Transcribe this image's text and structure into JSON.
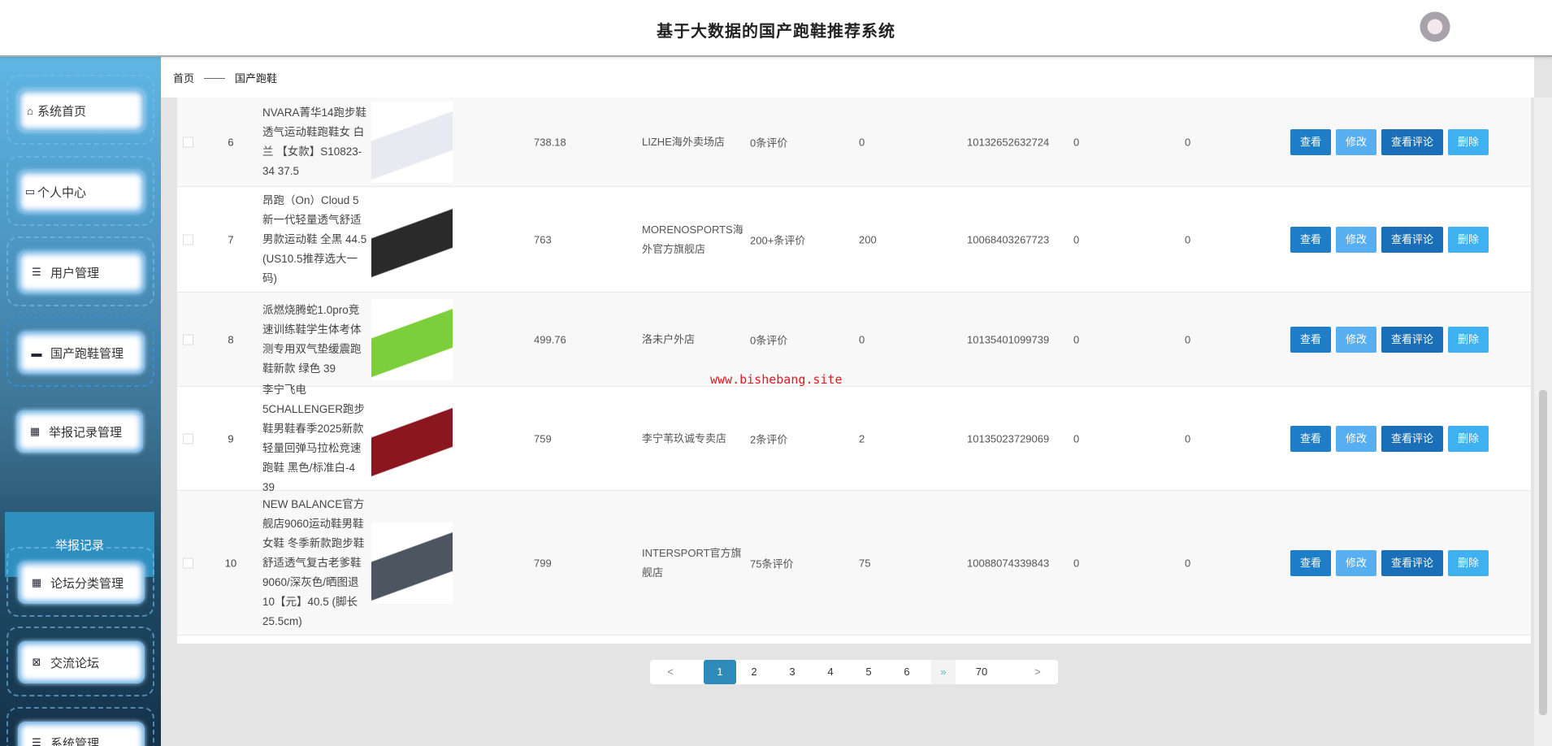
{
  "header": {
    "title": "基于大数据的国产跑鞋推荐系统"
  },
  "sidebar": {
    "items": [
      {
        "label": "系统首页",
        "icon": "home-icon"
      },
      {
        "label": "个人中心",
        "icon": "card-icon"
      },
      {
        "label": "用户管理",
        "icon": "list-icon"
      },
      {
        "label": "国产跑鞋管理",
        "icon": "monitor-icon"
      },
      {
        "label": "举报记录管理",
        "icon": "grid-icon"
      },
      {
        "label": "论坛分类管理",
        "icon": "grid-icon"
      },
      {
        "label": "交流论坛",
        "icon": "clipboard-icon"
      },
      {
        "label": "系统管理",
        "icon": "list-icon"
      }
    ],
    "sub_item": "举报记录"
  },
  "breadcrumb": {
    "home": "首页",
    "sep": "——",
    "current": "国产跑鞋"
  },
  "watermark": "www.bishebang.site",
  "actions": {
    "view": "查看",
    "edit": "修改",
    "comments": "查看评论",
    "delete": "删除"
  },
  "rows": [
    {
      "index": "6",
      "name": "NVARA菁华14跑步鞋透气运动鞋跑鞋女 白兰 【女款】S10823-34 37.5",
      "price": "738.18",
      "shop": "LIZHE海外卖场店",
      "reviews": "0条评价",
      "count": "0",
      "id": "10132652632724",
      "a": "0",
      "b": "0",
      "color": "#e9e9f2"
    },
    {
      "index": "7",
      "name": "昂跑（On）Cloud 5 新一代轻量透气舒适男款运动鞋 全黑 44.5 (US10.5推荐选大一码)",
      "price": "763",
      "shop": "MORENOSPORTS海外官方旗舰店",
      "reviews": "200+条评价",
      "count": "200",
      "id": "10068403267723",
      "a": "0",
      "b": "0",
      "color": "#2a2a2a"
    },
    {
      "index": "8",
      "name": "派燃烧腾蛇1.0pro竞速训练鞋学生体考体测专用双气垫缓震跑鞋新款 绿色 39",
      "price": "499.76",
      "shop": "洛未户外店",
      "reviews": "0条评价",
      "count": "0",
      "id": "10135401099739",
      "a": "0",
      "b": "0",
      "color": "#7ccf3a"
    },
    {
      "index": "9",
      "name": "李宁飞电5CHALLENGER跑步鞋男鞋春季2025新款轻量回弹马拉松竞速跑鞋 黑色/标准白-4 39",
      "price": "759",
      "shop": "李宁苇玖诚专卖店",
      "reviews": "2条评价",
      "count": "2",
      "id": "10135023729069",
      "a": "0",
      "b": "0",
      "color": "#8a1620"
    },
    {
      "index": "10",
      "name": "NEW BALANCE官方舰店9060运动鞋男鞋女鞋 冬季新款跑步鞋舒适透气复古老爹鞋 9060/深灰色/晒图退10【元】40.5 (脚长25.5cm)",
      "price": "799",
      "shop": "INTERSPORT官方旗舰店",
      "reviews": "75条评价",
      "count": "75",
      "id": "10088074339843",
      "a": "0",
      "b": "0",
      "color": "#4d5560"
    }
  ],
  "pagination": {
    "prev": "<",
    "pages": [
      "1",
      "2",
      "3",
      "4",
      "5",
      "6"
    ],
    "more": "»",
    "last": "70",
    "next": ">",
    "current": "1"
  }
}
